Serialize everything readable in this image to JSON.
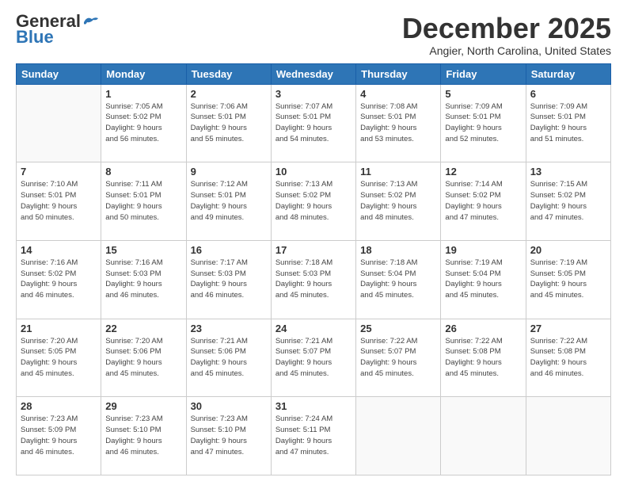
{
  "header": {
    "logo_general": "General",
    "logo_blue": "Blue",
    "month_title": "December 2025",
    "location": "Angier, North Carolina, United States"
  },
  "days_of_week": [
    "Sunday",
    "Monday",
    "Tuesday",
    "Wednesday",
    "Thursday",
    "Friday",
    "Saturday"
  ],
  "weeks": [
    [
      {
        "day": "",
        "sunrise": "",
        "sunset": "",
        "daylight": ""
      },
      {
        "day": "1",
        "sunrise": "Sunrise: 7:05 AM",
        "sunset": "Sunset: 5:02 PM",
        "daylight": "Daylight: 9 hours and 56 minutes."
      },
      {
        "day": "2",
        "sunrise": "Sunrise: 7:06 AM",
        "sunset": "Sunset: 5:01 PM",
        "daylight": "Daylight: 9 hours and 55 minutes."
      },
      {
        "day": "3",
        "sunrise": "Sunrise: 7:07 AM",
        "sunset": "Sunset: 5:01 PM",
        "daylight": "Daylight: 9 hours and 54 minutes."
      },
      {
        "day": "4",
        "sunrise": "Sunrise: 7:08 AM",
        "sunset": "Sunset: 5:01 PM",
        "daylight": "Daylight: 9 hours and 53 minutes."
      },
      {
        "day": "5",
        "sunrise": "Sunrise: 7:09 AM",
        "sunset": "Sunset: 5:01 PM",
        "daylight": "Daylight: 9 hours and 52 minutes."
      },
      {
        "day": "6",
        "sunrise": "Sunrise: 7:09 AM",
        "sunset": "Sunset: 5:01 PM",
        "daylight": "Daylight: 9 hours and 51 minutes."
      }
    ],
    [
      {
        "day": "7",
        "sunrise": "Sunrise: 7:10 AM",
        "sunset": "Sunset: 5:01 PM",
        "daylight": "Daylight: 9 hours and 50 minutes."
      },
      {
        "day": "8",
        "sunrise": "Sunrise: 7:11 AM",
        "sunset": "Sunset: 5:01 PM",
        "daylight": "Daylight: 9 hours and 50 minutes."
      },
      {
        "day": "9",
        "sunrise": "Sunrise: 7:12 AM",
        "sunset": "Sunset: 5:01 PM",
        "daylight": "Daylight: 9 hours and 49 minutes."
      },
      {
        "day": "10",
        "sunrise": "Sunrise: 7:13 AM",
        "sunset": "Sunset: 5:02 PM",
        "daylight": "Daylight: 9 hours and 48 minutes."
      },
      {
        "day": "11",
        "sunrise": "Sunrise: 7:13 AM",
        "sunset": "Sunset: 5:02 PM",
        "daylight": "Daylight: 9 hours and 48 minutes."
      },
      {
        "day": "12",
        "sunrise": "Sunrise: 7:14 AM",
        "sunset": "Sunset: 5:02 PM",
        "daylight": "Daylight: 9 hours and 47 minutes."
      },
      {
        "day": "13",
        "sunrise": "Sunrise: 7:15 AM",
        "sunset": "Sunset: 5:02 PM",
        "daylight": "Daylight: 9 hours and 47 minutes."
      }
    ],
    [
      {
        "day": "14",
        "sunrise": "Sunrise: 7:16 AM",
        "sunset": "Sunset: 5:02 PM",
        "daylight": "Daylight: 9 hours and 46 minutes."
      },
      {
        "day": "15",
        "sunrise": "Sunrise: 7:16 AM",
        "sunset": "Sunset: 5:03 PM",
        "daylight": "Daylight: 9 hours and 46 minutes."
      },
      {
        "day": "16",
        "sunrise": "Sunrise: 7:17 AM",
        "sunset": "Sunset: 5:03 PM",
        "daylight": "Daylight: 9 hours and 46 minutes."
      },
      {
        "day": "17",
        "sunrise": "Sunrise: 7:18 AM",
        "sunset": "Sunset: 5:03 PM",
        "daylight": "Daylight: 9 hours and 45 minutes."
      },
      {
        "day": "18",
        "sunrise": "Sunrise: 7:18 AM",
        "sunset": "Sunset: 5:04 PM",
        "daylight": "Daylight: 9 hours and 45 minutes."
      },
      {
        "day": "19",
        "sunrise": "Sunrise: 7:19 AM",
        "sunset": "Sunset: 5:04 PM",
        "daylight": "Daylight: 9 hours and 45 minutes."
      },
      {
        "day": "20",
        "sunrise": "Sunrise: 7:19 AM",
        "sunset": "Sunset: 5:05 PM",
        "daylight": "Daylight: 9 hours and 45 minutes."
      }
    ],
    [
      {
        "day": "21",
        "sunrise": "Sunrise: 7:20 AM",
        "sunset": "Sunset: 5:05 PM",
        "daylight": "Daylight: 9 hours and 45 minutes."
      },
      {
        "day": "22",
        "sunrise": "Sunrise: 7:20 AM",
        "sunset": "Sunset: 5:06 PM",
        "daylight": "Daylight: 9 hours and 45 minutes."
      },
      {
        "day": "23",
        "sunrise": "Sunrise: 7:21 AM",
        "sunset": "Sunset: 5:06 PM",
        "daylight": "Daylight: 9 hours and 45 minutes."
      },
      {
        "day": "24",
        "sunrise": "Sunrise: 7:21 AM",
        "sunset": "Sunset: 5:07 PM",
        "daylight": "Daylight: 9 hours and 45 minutes."
      },
      {
        "day": "25",
        "sunrise": "Sunrise: 7:22 AM",
        "sunset": "Sunset: 5:07 PM",
        "daylight": "Daylight: 9 hours and 45 minutes."
      },
      {
        "day": "26",
        "sunrise": "Sunrise: 7:22 AM",
        "sunset": "Sunset: 5:08 PM",
        "daylight": "Daylight: 9 hours and 45 minutes."
      },
      {
        "day": "27",
        "sunrise": "Sunrise: 7:22 AM",
        "sunset": "Sunset: 5:08 PM",
        "daylight": "Daylight: 9 hours and 46 minutes."
      }
    ],
    [
      {
        "day": "28",
        "sunrise": "Sunrise: 7:23 AM",
        "sunset": "Sunset: 5:09 PM",
        "daylight": "Daylight: 9 hours and 46 minutes."
      },
      {
        "day": "29",
        "sunrise": "Sunrise: 7:23 AM",
        "sunset": "Sunset: 5:10 PM",
        "daylight": "Daylight: 9 hours and 46 minutes."
      },
      {
        "day": "30",
        "sunrise": "Sunrise: 7:23 AM",
        "sunset": "Sunset: 5:10 PM",
        "daylight": "Daylight: 9 hours and 47 minutes."
      },
      {
        "day": "31",
        "sunrise": "Sunrise: 7:24 AM",
        "sunset": "Sunset: 5:11 PM",
        "daylight": "Daylight: 9 hours and 47 minutes."
      },
      {
        "day": "",
        "sunrise": "",
        "sunset": "",
        "daylight": ""
      },
      {
        "day": "",
        "sunrise": "",
        "sunset": "",
        "daylight": ""
      },
      {
        "day": "",
        "sunrise": "",
        "sunset": "",
        "daylight": ""
      }
    ]
  ]
}
